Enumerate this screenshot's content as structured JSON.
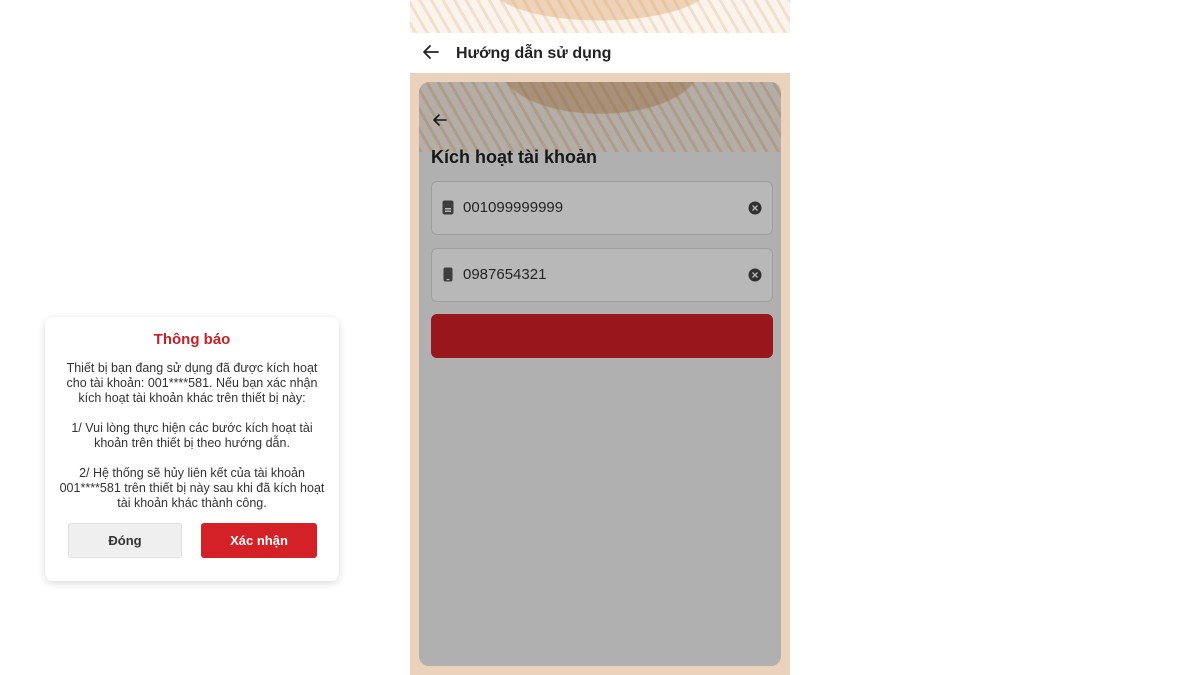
{
  "app": {
    "header_title": "Hướng dẫn sử dụng",
    "back_icon": "arrow-left-icon"
  },
  "screen": {
    "title": "Kích hoạt tài khoản",
    "fields": [
      {
        "icon": "id-card-icon",
        "value": "001099999999"
      },
      {
        "icon": "phone-icon",
        "value": "0987654321"
      }
    ],
    "submit_button_color": "#d42127"
  },
  "dialog": {
    "title": "Thông báo",
    "paragraphs": [
      "Thiết bị bạn đang sử dụng đã được kích hoạt cho tài khoản: 001****581. Nếu bạn xác nhận kích hoạt tài khoản khác trên thiết bị này:",
      "1/ Vui lòng thực hiện các bước kích hoạt tài khoản trên thiết bị theo hướng dẫn.",
      "2/ Hệ thống sẽ hủy liên kết của tài khoản 001****581 trên thiết bị này sau khi đã kích hoạt tài khoản khác thành công."
    ],
    "close_label": "Đóng",
    "confirm_label": "Xác nhận"
  },
  "colors": {
    "accent": "#d42127",
    "dialog_title": "#c62127",
    "frame": "#ead2bd"
  }
}
